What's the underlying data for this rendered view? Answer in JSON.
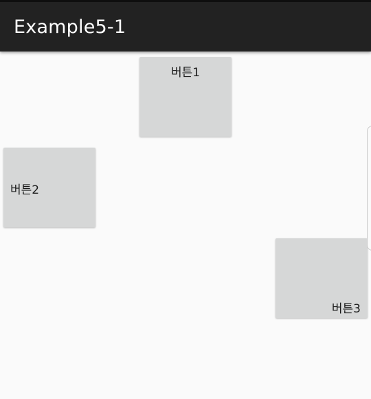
{
  "app": {
    "title": "Example5-1"
  },
  "buttons": {
    "button1": "버튼1",
    "button2": "버튼2",
    "button3": "버튼3"
  },
  "colors": {
    "toolbar": "#222222",
    "background": "#fafafa",
    "button": "#d6d7d7"
  }
}
